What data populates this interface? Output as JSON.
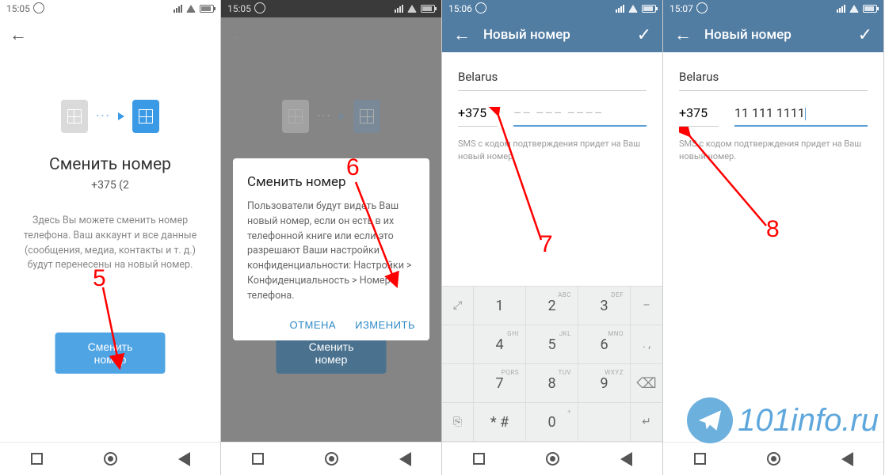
{
  "annotations": {
    "n5": "5",
    "n6": "6",
    "n7": "7",
    "n8": "8"
  },
  "watermark": "101info.ru",
  "status": {
    "t1": "15:05",
    "t2": "15:05",
    "t3": "15:06",
    "t4": "15:07"
  },
  "screen1": {
    "title": "Сменить номер",
    "phone": "+375 (2",
    "description": "Здесь Вы можете сменить номер телефона. Ваш аккаунт и все данные (сообщения, медиа, контакты и т. д.) будут перенесены на новый номер.",
    "button": "Сменить номер"
  },
  "dialog": {
    "title": "Сменить номер",
    "body": "Пользователи будут видеть Ваш новый номер, если он есть в их телефонной книге или если это разрешают Ваши настройки конфиденциальности: Настройки > Конфиденциальность > Номер телефона.",
    "cancel": "ОТМЕНА",
    "confirm": "ИЗМЕНИТЬ"
  },
  "form": {
    "header": "Новый номер",
    "country": "Belarus",
    "code": "+375",
    "placeholder": "–– ––– ––––",
    "value": "11 111 1111",
    "hint": "SMS с кодом подтверждения придет на Ваш новый номер."
  },
  "keyboard": {
    "k1": "1",
    "k2": "2",
    "k3": "3",
    "k4": "4",
    "k5": "5",
    "k6": "6",
    "k7": "7",
    "k8": "8",
    "k9": "9",
    "k0": "0",
    "s2": "ABC",
    "s3": "DEF",
    "s4": "GHI",
    "s5": "JKL",
    "s6": "MNO",
    "s7": "PQRS",
    "s8": "TUV",
    "s9": "WXYZ",
    "star": "*  #",
    "plus": "+",
    "minus": "–",
    "comma": ".  ,"
  }
}
